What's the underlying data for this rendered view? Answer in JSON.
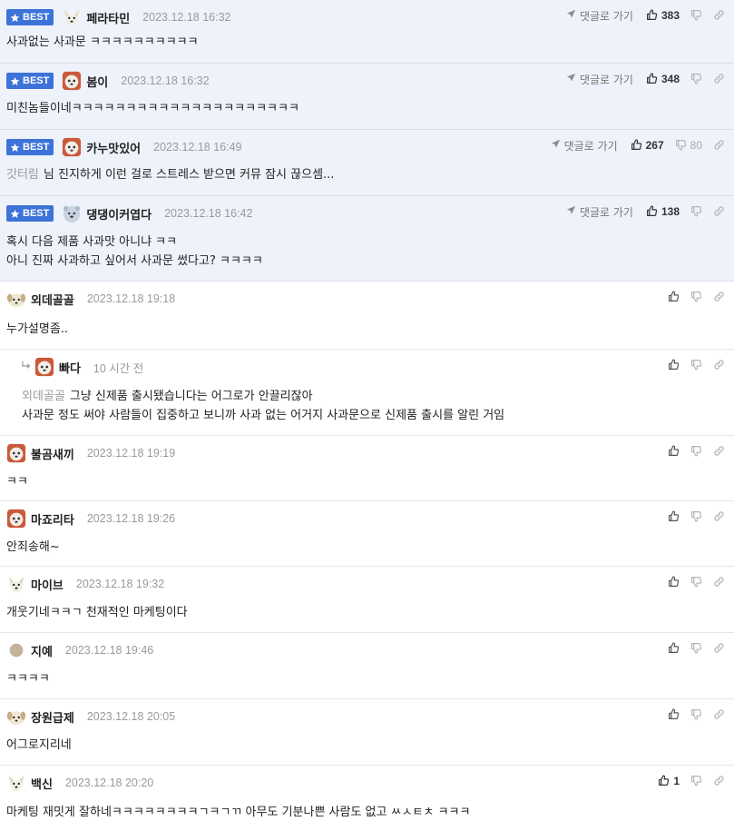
{
  "comments": [
    {
      "best": true,
      "badge": "BEST",
      "avatar": "dog-avatar",
      "nick": "페라타민",
      "date": "2023.12.18 16:32",
      "reply_label": "댓글로 가기",
      "likes": "383",
      "lines": [
        "사과없는 사과문 ㅋㅋㅋㅋㅋㅋㅋㅋㅋㅋ"
      ]
    },
    {
      "best": true,
      "badge": "BEST",
      "avatar": "fox-avatar",
      "nick": "봄이",
      "date": "2023.12.18 16:32",
      "reply_label": "댓글로 가기",
      "likes": "348",
      "lines": [
        "미친놈들이네ㅋㅋㅋㅋㅋㅋㅋㅋㅋㅋㅋㅋㅋㅋㅋㅋㅋㅋㅋㅋㅋ"
      ]
    },
    {
      "best": true,
      "badge": "BEST",
      "avatar": "fox-avatar",
      "nick": "카누맛있어",
      "date": "2023.12.18 16:49",
      "reply_label": "댓글로 가기",
      "likes": "267",
      "dislikes": "80",
      "mention": "갓터림",
      "lines": [
        "님 진지하게 이런 걸로 스트레스 받으면 커뮤 잠시 끊으셈..."
      ]
    },
    {
      "best": true,
      "badge": "BEST",
      "avatar": "bear-avatar",
      "nick": "댕댕이커엽다",
      "date": "2023.12.18 16:42",
      "reply_label": "댓글로 가기",
      "likes": "138",
      "lines": [
        "혹시 다음 제품 사과맛 아니냐 ㅋㅋ",
        "아니 진짜 사과하고 싶어서 사과문 썼다고? ㅋㅋㅋㅋ"
      ]
    },
    {
      "avatar": "puppy-avatar",
      "nick": "외데골골",
      "date": "2023.12.18 19:18",
      "lines": [
        "누가설명좀.."
      ]
    },
    {
      "reply": true,
      "avatar": "fox-avatar",
      "nick": "빠다",
      "date": "10 시간 전",
      "mention": "외데골골",
      "lines": [
        "그냥 신제품 출시됐습니다는 어그로가 안끌리잖아",
        "사과문 정도 써야 사람들이 집중하고 보니까 사과 없는 어거지 사과문으로 신제품 출시를 알린 거임"
      ]
    },
    {
      "avatar": "fox-avatar",
      "nick": "불곰새끼",
      "date": "2023.12.18 19:19",
      "lines": [
        "ㅋㅋ"
      ]
    },
    {
      "avatar": "fox-avatar",
      "nick": "마죠리타",
      "date": "2023.12.18 19:26",
      "lines": [
        "안죄송해~"
      ]
    },
    {
      "avatar": "dog-avatar",
      "nick": "마이브",
      "date": "2023.12.18 19:32",
      "lines": [
        "개웃기네ㅋㅋㄱ 천재적인 마케팅이다"
      ]
    },
    {
      "avatar": "dot-avatar",
      "nick": "지예",
      "date": "2023.12.18 19:46",
      "lines": [
        "ㅋㅋㅋㅋ"
      ]
    },
    {
      "avatar": "puppy-avatar",
      "nick": "장원급제",
      "date": "2023.12.18 20:05",
      "lines": [
        "어그로지리네"
      ]
    },
    {
      "avatar": "dog-avatar",
      "nick": "백신",
      "date": "2023.12.18 20:20",
      "likes": "1",
      "lines": [
        "마케팅 재밋게 잘하네ㅋㅋㅋㅋㅋㅋㅋㅋㄱㅋㄱㄲ 아무도 기분나쁜 사람도 없고 ㅆㅅㅌㅊ ㅋㅋㅋ"
      ]
    }
  ]
}
